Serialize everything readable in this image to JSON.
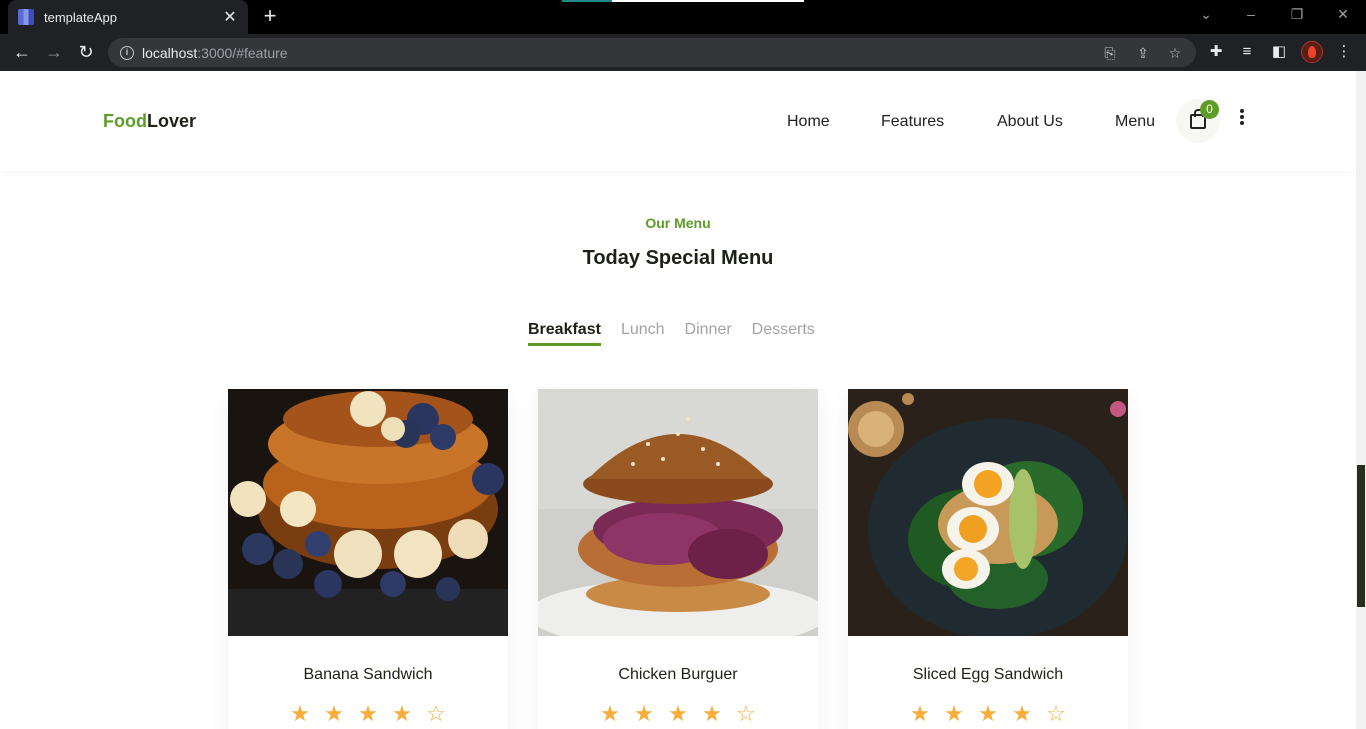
{
  "browser": {
    "tab_title": "templateApp",
    "url_host": "localhost",
    "url_rest": ":3000/#feature"
  },
  "header": {
    "logo_part1": "Food",
    "logo_part2": "Lover",
    "nav": [
      "Home",
      "Features",
      "About Us",
      "Menu"
    ],
    "cart_count": "0"
  },
  "section": {
    "eyebrow": "Our Menu",
    "title": "Today Special Menu",
    "tabs": [
      "Breakfast",
      "Lunch",
      "Dinner",
      "Desserts"
    ],
    "active_tab": "Breakfast"
  },
  "items": [
    {
      "name": "Banana Sandwich",
      "rating": 4.5
    },
    {
      "name": "Chicken Burguer",
      "rating": 4.5
    },
    {
      "name": "Sliced Egg Sandwich",
      "rating": 4.5
    }
  ],
  "colors": {
    "brand_green": "#5d9c26",
    "dark_text": "#1c2216",
    "star": "#f6ad3a"
  }
}
